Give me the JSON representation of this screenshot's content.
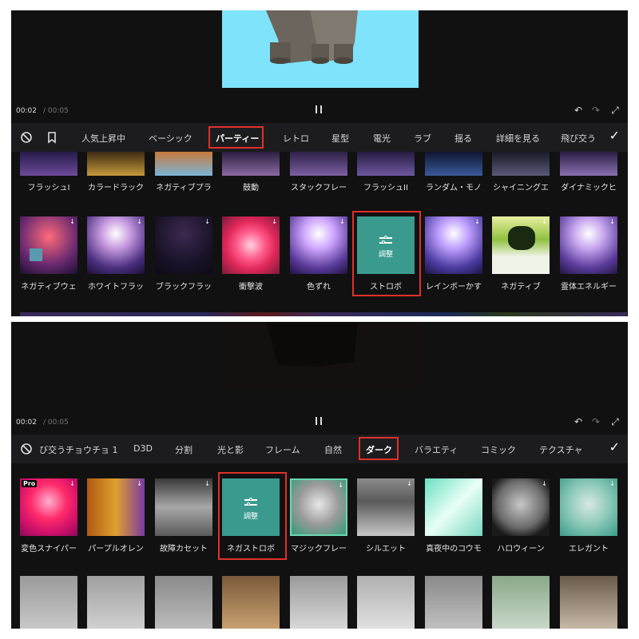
{
  "panel1": {
    "time_current": "00:02",
    "time_total": "/ 00:05",
    "tabs": [
      "人気上昇中",
      "ベーシック",
      "パーティー",
      "レトロ",
      "星型",
      "電光",
      "ラブ",
      "揺る",
      "詳細を見る",
      "飛び交う"
    ],
    "active_tab": "パーティー",
    "top_row_captions": [
      "フラッシュI",
      "カラードラック",
      "ネガティブプラ",
      "鼓動",
      "スタックフレー",
      "フラッシュII",
      "ランダム・モノ",
      "シャイニングエ",
      "ダイナミックヒ"
    ],
    "main_row_captions": [
      "ネガティブウェ",
      "ホワイトフラッ",
      "ブラックフラッ",
      "衝撃波",
      "色ずれ",
      "ストロボ",
      "レインボーかす",
      "ネガティブ",
      "霊体エネルギー"
    ],
    "adjust_label": "調整",
    "highlighted_effect": "ストロボ"
  },
  "panel2": {
    "time_current": "00:02",
    "time_total": "/ 00:05",
    "tabs": [
      "び交うチョウチョ 1",
      "D3D",
      "分割",
      "光と影",
      "フレーム",
      "自然",
      "ダーク",
      "バラエティ",
      "コミック",
      "テクスチャ"
    ],
    "active_tab": "ダーク",
    "main_row_captions": [
      "変色スナイパー",
      "パープルオレン",
      "故障カセット",
      "ネガストロボ",
      "マジックフレー",
      "シルエット",
      "真夜中のコウモ",
      "ハロウィーン",
      "エレガント"
    ],
    "pro_badge": "Pro",
    "adjust_label": "調整",
    "highlighted_effect": "ネガストロボ"
  },
  "colors": {
    "accent_red": "#e0302a",
    "adjust_teal": "#3a9a8e",
    "preview_sky": "#7fe3fb"
  }
}
